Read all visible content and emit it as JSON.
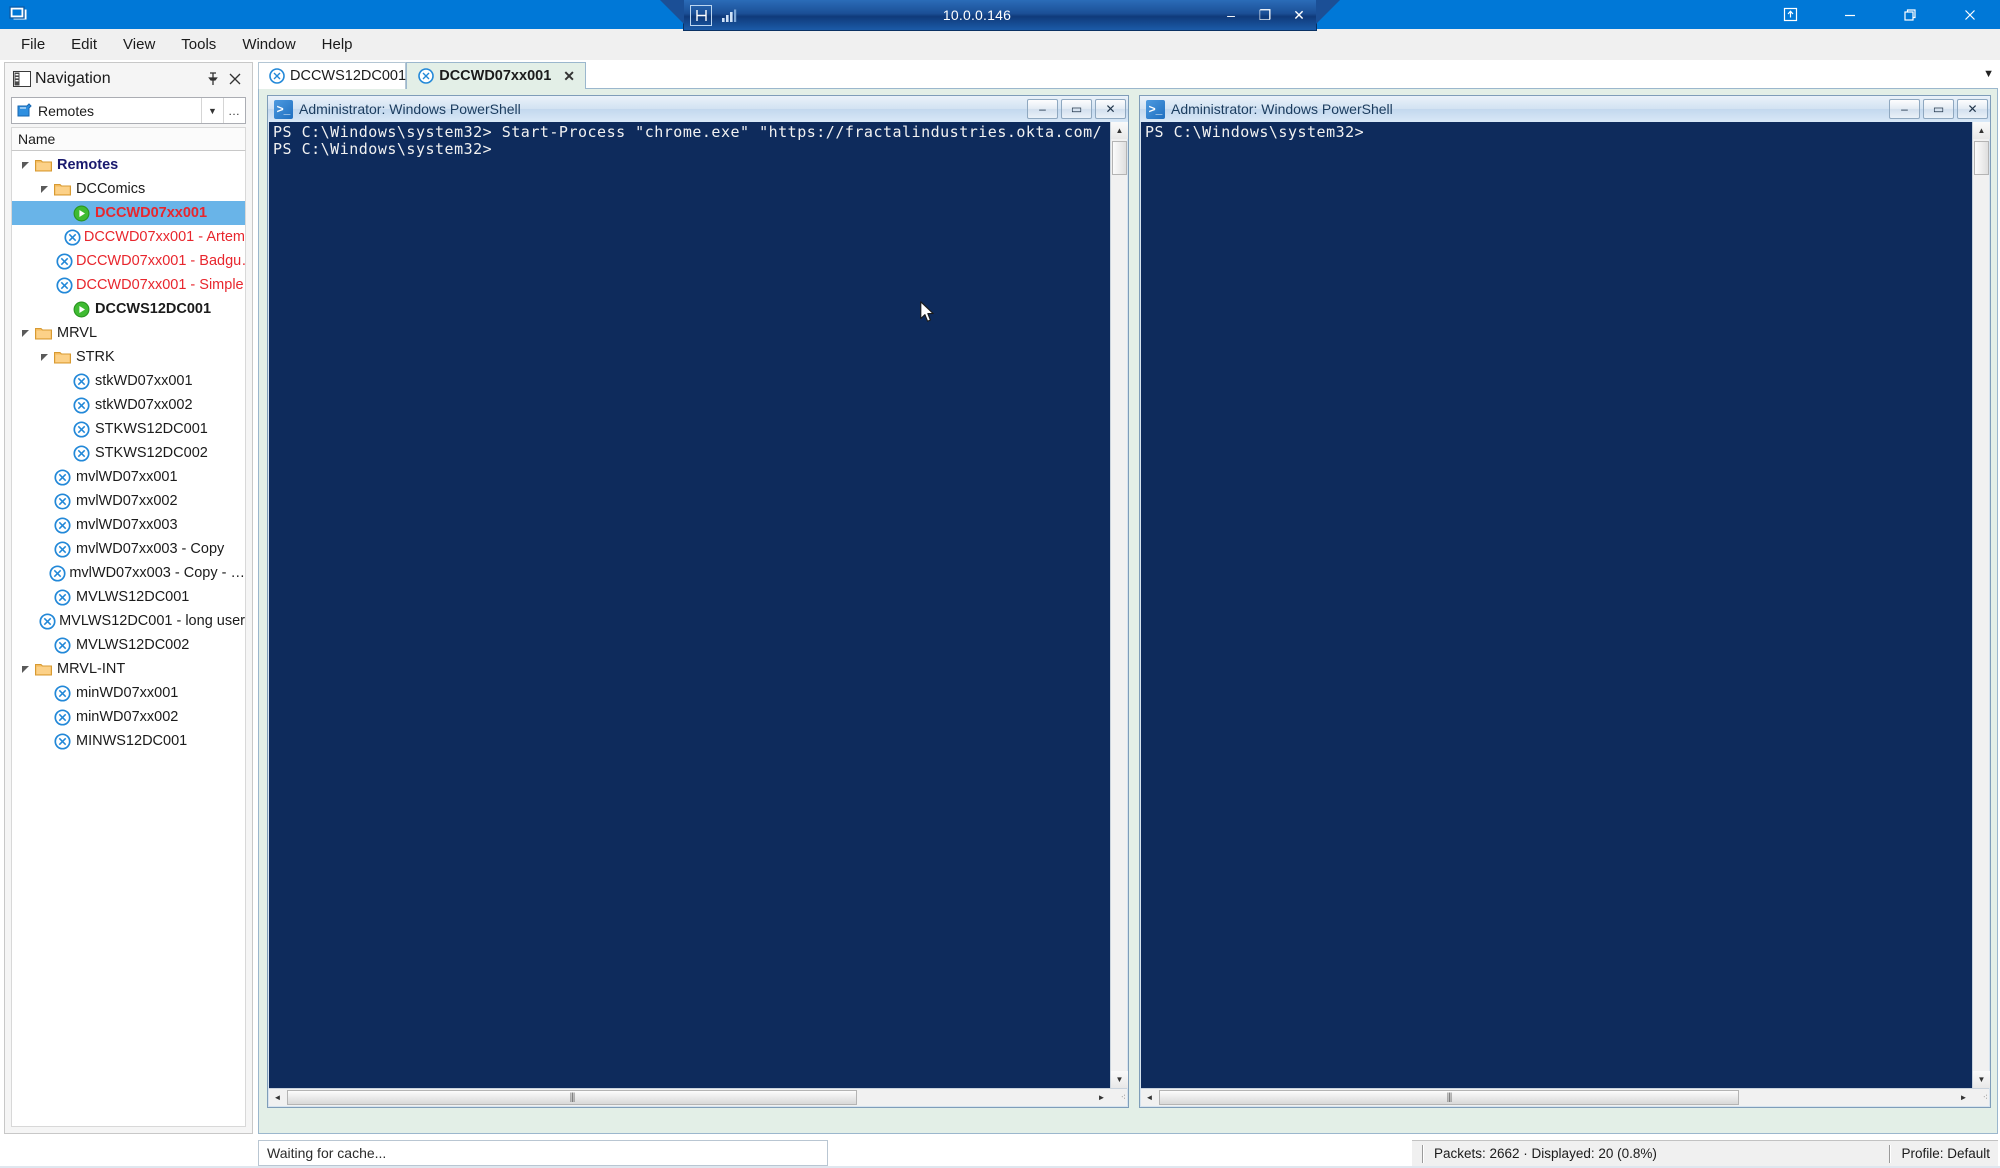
{
  "window": {
    "app_icon": "remote-desktop-icon",
    "controls": {
      "restore_up": "restore-up-icon",
      "minimize": "–",
      "maximize": "❐",
      "close": "✕"
    }
  },
  "session_toolbar": {
    "pin_icon": "pin-icon",
    "signal_icon": "signal-bars-icon",
    "title": "10.0.0.146",
    "minimize": "–",
    "restore": "❐",
    "close": "✕"
  },
  "menubar": {
    "items": [
      {
        "label": "File"
      },
      {
        "label": "Edit"
      },
      {
        "label": "View"
      },
      {
        "label": "Tools"
      },
      {
        "label": "Window"
      },
      {
        "label": "Help"
      }
    ]
  },
  "navigation": {
    "icon": "panel-layout-icon",
    "title": "Navigation",
    "pin_icon": "pin-icon",
    "close_icon": "close-icon",
    "combo": {
      "icon": "edit-pencil-icon",
      "value": "Remotes",
      "arrow": "▼",
      "more": "…"
    },
    "column_header": "Name",
    "tree": [
      {
        "depth": 0,
        "expander": "collapse",
        "icon": "folder-icon",
        "label": "Remotes",
        "style": "navy"
      },
      {
        "depth": 1,
        "expander": "collapse",
        "icon": "folder-icon",
        "label": "DCComics",
        "style": "dark"
      },
      {
        "depth": 2,
        "expander": "none",
        "icon": "connected-icon",
        "label": "DCCWD07xx001",
        "style": "redb",
        "selected": true
      },
      {
        "depth": 2,
        "expander": "none",
        "icon": "disconnected-icon",
        "label": "DCCWD07xx001 - Artem",
        "style": "red"
      },
      {
        "depth": 2,
        "expander": "none",
        "icon": "disconnected-icon",
        "label": "DCCWD07xx001 - Badgu…",
        "style": "red"
      },
      {
        "depth": 2,
        "expander": "none",
        "icon": "disconnected-icon",
        "label": "DCCWD07xx001 - Simple…",
        "style": "red"
      },
      {
        "depth": 2,
        "expander": "none",
        "icon": "connected-icon",
        "label": "DCCWS12DC001",
        "style": "blackb"
      },
      {
        "depth": 0,
        "expander": "collapse",
        "icon": "folder-icon",
        "label": "MRVL",
        "style": "dark"
      },
      {
        "depth": 1,
        "expander": "collapse",
        "icon": "folder-icon",
        "label": "STRK",
        "style": "dark"
      },
      {
        "depth": 2,
        "expander": "none",
        "icon": "disconnected-icon",
        "label": "stkWD07xx001",
        "style": "dark"
      },
      {
        "depth": 2,
        "expander": "none",
        "icon": "disconnected-icon",
        "label": "stkWD07xx002",
        "style": "dark"
      },
      {
        "depth": 2,
        "expander": "none",
        "icon": "disconnected-icon",
        "label": "STKWS12DC001",
        "style": "dark"
      },
      {
        "depth": 2,
        "expander": "none",
        "icon": "disconnected-icon",
        "label": "STKWS12DC002",
        "style": "dark"
      },
      {
        "depth": 1,
        "expander": "none",
        "icon": "disconnected-icon",
        "label": "mvlWD07xx001",
        "style": "dark"
      },
      {
        "depth": 1,
        "expander": "none",
        "icon": "disconnected-icon",
        "label": "mvlWD07xx002",
        "style": "dark"
      },
      {
        "depth": 1,
        "expander": "none",
        "icon": "disconnected-icon",
        "label": "mvlWD07xx003",
        "style": "dark"
      },
      {
        "depth": 1,
        "expander": "none",
        "icon": "disconnected-icon",
        "label": "mvlWD07xx003 - Copy",
        "style": "dark"
      },
      {
        "depth": 1,
        "expander": "none",
        "icon": "disconnected-icon",
        "label": "mvlWD07xx003 - Copy - …",
        "style": "dark"
      },
      {
        "depth": 1,
        "expander": "none",
        "icon": "disconnected-icon",
        "label": "MVLWS12DC001",
        "style": "dark"
      },
      {
        "depth": 1,
        "expander": "none",
        "icon": "disconnected-icon",
        "label": "MVLWS12DC001 - long user",
        "style": "dark"
      },
      {
        "depth": 1,
        "expander": "none",
        "icon": "disconnected-icon",
        "label": "MVLWS12DC002",
        "style": "dark"
      },
      {
        "depth": 0,
        "expander": "collapse",
        "icon": "folder-icon",
        "label": "MRVL-INT",
        "style": "dark"
      },
      {
        "depth": 1,
        "expander": "none",
        "icon": "disconnected-icon",
        "label": "minWD07xx001",
        "style": "dark"
      },
      {
        "depth": 1,
        "expander": "none",
        "icon": "disconnected-icon",
        "label": "minWD07xx002",
        "style": "dark"
      },
      {
        "depth": 1,
        "expander": "none",
        "icon": "disconnected-icon",
        "label": "MINWS12DC001",
        "style": "dark"
      }
    ]
  },
  "tabs": {
    "chevron": "▼",
    "items": [
      {
        "label": "DCCWS12DC001",
        "icon": "disconnected-icon",
        "active": false,
        "closable": false
      },
      {
        "label": "DCCWD07xx001",
        "icon": "disconnected-icon",
        "active": true,
        "closable": true,
        "close": "✕"
      }
    ]
  },
  "consoles": [
    {
      "title": "Administrator: Windows PowerShell",
      "icon": "powershell-icon",
      "buttons": {
        "minimize": "–",
        "maximize": "▭",
        "close": "✕"
      },
      "lines": [
        "PS C:\\Windows\\system32> Start-Process \"chrome.exe\" \"https://fractalindustries.okta.com/",
        "PS C:\\Windows\\system32>"
      ],
      "scroll": {
        "up": "▲",
        "down": "▼",
        "left": "◄",
        "right": "►",
        "grip": "⁖"
      }
    },
    {
      "title": "Administrator: Windows PowerShell",
      "icon": "powershell-icon",
      "buttons": {
        "minimize": "–",
        "maximize": "▭",
        "close": "✕"
      },
      "lines": [
        "PS C:\\Windows\\system32>"
      ],
      "scroll": {
        "up": "▲",
        "down": "▼",
        "left": "◄",
        "right": "►",
        "grip": "⁖"
      }
    }
  ],
  "status": {
    "left_text": "Waiting for cache...",
    "packets": "Packets: 2662 · Displayed: 20 (0.8%)",
    "profile": "Profile: Default"
  },
  "colors": {
    "accent": "#0078d7",
    "console_bg": "#0e2b5c",
    "selection": "#69b4e8",
    "red_label": "#e8262d",
    "tab_active": "#e3efe7"
  }
}
